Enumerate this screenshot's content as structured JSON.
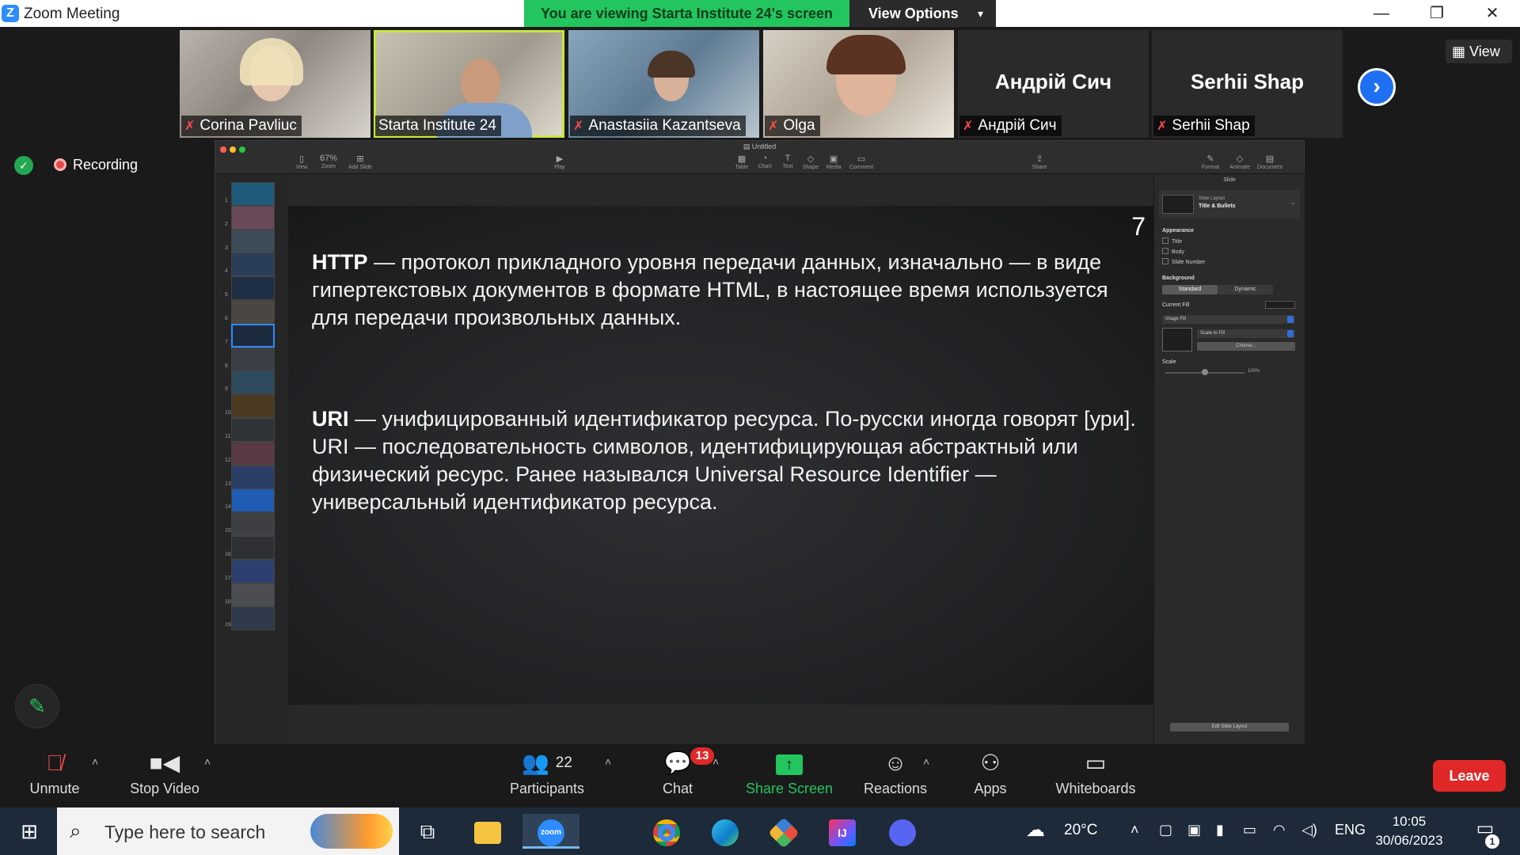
{
  "titlebar": {
    "app_title": "Zoom Meeting",
    "viewing_banner": "You are viewing Starta Institute 24's screen",
    "view_options": "View Options",
    "minimize": "—",
    "restore": "❐",
    "close": "✕"
  },
  "participants": [
    {
      "name": "Corina Pavliuc",
      "muted": true
    },
    {
      "name": "Starta Institute 24",
      "muted": false,
      "active": true
    },
    {
      "name": "Anastasiia Kazantseva",
      "muted": true
    },
    {
      "name": "Olga",
      "muted": true
    },
    {
      "name": "Андрій Сич",
      "display": "Андрій Сич",
      "muted": true
    },
    {
      "name": "Serhii Shap",
      "display": "Serhii Shap",
      "muted": true
    }
  ],
  "view_button": "View",
  "recording": "Recording",
  "keynote": {
    "doc_title": "Untitled",
    "toolbar_left": [
      "View",
      "Zoom",
      "Add Slide"
    ],
    "zoom_value": "67%",
    "play": "Play",
    "toolbar_mid": [
      "Table",
      "Chart",
      "Text",
      "Shape",
      "Media",
      "Comment"
    ],
    "share": "Share",
    "toolbar_right": [
      "Format",
      "Animate",
      "Document"
    ],
    "thumb_numbers": [
      "1",
      "2",
      "3",
      "4",
      "5",
      "6",
      "7",
      "8",
      "9",
      "10",
      "11",
      "12",
      "13",
      "14",
      "15",
      "16",
      "17",
      "18",
      "19"
    ],
    "slide": {
      "number": "7",
      "p1_bold": "HTTP",
      "p1_rest": " — протокол прикладного уровня передачи данных, изначально — в виде гипертекстовых документов в формате HTML, в настоящее время используется для передачи произвольных данных.",
      "p2_bold": "URI",
      "p2_rest": " — унифицированный идентификатор ресурса. По-русски иногда говорят [ури]. URI — последовательность символов, идентифицирующая абстрактный или физический ресурс. Ранее назывался Universal Resource Identifier — универсальный идентификатор ресурса."
    },
    "inspector": {
      "tab": "Slide",
      "layout_label": "Slide Layout",
      "layout_value": "Title & Bullets",
      "appearance": "Appearance",
      "checks": [
        "Title",
        "Body",
        "Slide Number"
      ],
      "background": "Background",
      "bg_standard": "Standard",
      "bg_dynamic": "Dynamic",
      "current_fill": "Current Fill",
      "fill_type": "Image Fill",
      "scale_mode": "Scale to Fill",
      "choose": "Choose...",
      "scale": "Scale",
      "scale_value": "100%",
      "edit_layout": "Edit Slide Layout"
    }
  },
  "toolbar": {
    "unmute": "Unmute",
    "stop_video": "Stop Video",
    "participants_label": "Participants",
    "participants_count": "22",
    "chat": "Chat",
    "chat_badge": "13",
    "share_screen": "Share Screen",
    "reactions": "Reactions",
    "apps": "Apps",
    "whiteboards": "Whiteboards",
    "leave": "Leave"
  },
  "taskbar": {
    "search_placeholder": "Type here to search",
    "weather": "20°C",
    "language": "ENG",
    "time": "10:05",
    "date": "30/06/2023",
    "notifications": "1",
    "zoom_label": "zoom"
  }
}
